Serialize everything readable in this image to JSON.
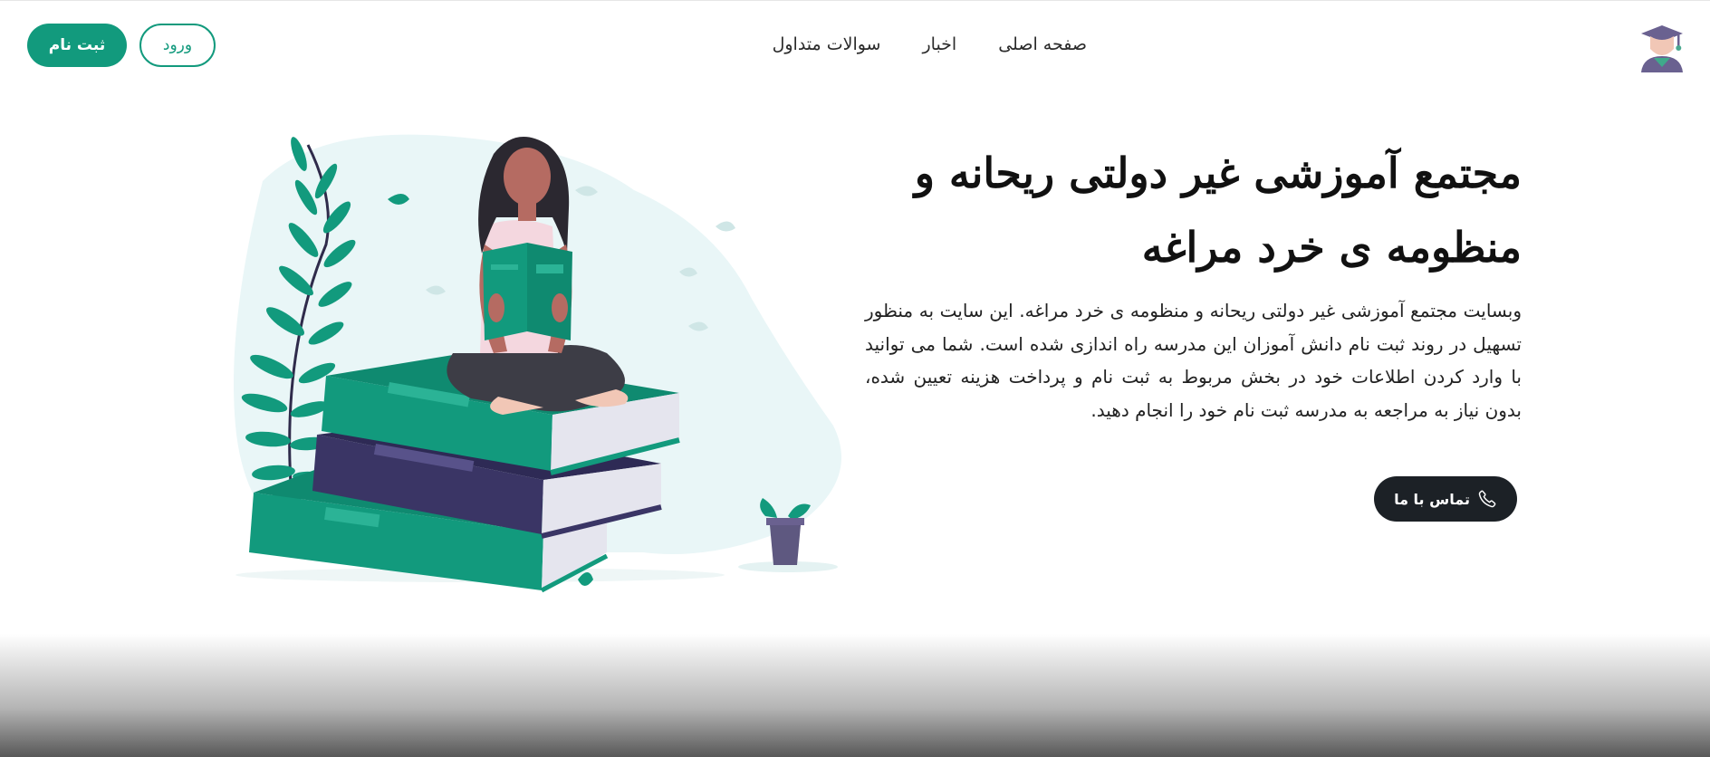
{
  "nav": {
    "logo_icon": "graduate-avatar-icon",
    "menu": [
      {
        "label": "صفحه اصلی"
      },
      {
        "label": "اخبار"
      },
      {
        "label": "سوالات متداول"
      }
    ],
    "login_label": "ورود",
    "register_label": "ثبت نام"
  },
  "hero": {
    "title": "مجتمع آموزشی غیر دولتی ریحانه و منظومه ی خرد مراغه",
    "description": "وبسایت مجتمع آموزشی غیر دولتی ریحانه و منظومه ی خرد مراغه. این سایت به منظور تسهیل در روند ثبت نام دانش آموزان این مدرسه راه اندازی شده است. شما می توانید با وارد کردن اطلاعات خود در بخش مربوط به ثبت نام و پرداخت هزینه تعیین شده، بدون نیاز به مراجعه به مدرسه ثبت نام خود را انجام دهید.",
    "contact_label": "تماس با ما",
    "contact_icon": "phone-icon",
    "illustration": "girl-reading-on-books-illustration"
  },
  "colors": {
    "accent": "#129a7d",
    "dark_button": "#1c2126",
    "book_green": "#0f9a7c",
    "book_navy": "#3a3565",
    "blob": "#e9f6f7"
  }
}
